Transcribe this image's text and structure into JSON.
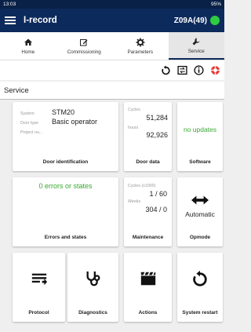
{
  "status": {
    "time": "13:03",
    "battery": "95%"
  },
  "app": {
    "title": "I-record",
    "device": "Z09A(49)"
  },
  "tabs": [
    {
      "label": "Home",
      "icon": "home-icon"
    },
    {
      "label": "Commissioning",
      "icon": "edit-icon"
    },
    {
      "label": "Parameters",
      "icon": "gear-icon"
    },
    {
      "label": "Service",
      "icon": "wrench-icon"
    }
  ],
  "section": {
    "title": "Service"
  },
  "door": {
    "system_label": "System",
    "system": "STM20",
    "doortype_label": "Door type",
    "doortype": "Basic operator",
    "project_label": "Project nu...",
    "caption": "Door identification"
  },
  "doordata": {
    "cycles_label": "Cycles",
    "cycles": "51,284",
    "hours_label": "hours",
    "hours": "92,926",
    "caption": "Door data"
  },
  "software": {
    "status": "no updates",
    "caption": "Software"
  },
  "errors": {
    "status": "0 errors or states",
    "caption": "Errors and states"
  },
  "maintenance": {
    "cycles_label": "Cycles (x1000)",
    "cycles": "1 / 60",
    "weeks_label": "Weeks",
    "weeks": "304 / 0",
    "caption": "Maintenance"
  },
  "opmode": {
    "mode": "Automatic",
    "caption": "Opmode"
  },
  "tiles": {
    "protocol": "Protocol",
    "diagnostics": "Diagnostics",
    "actions": "Actions",
    "restart": "System restart"
  },
  "colors": {
    "appbar": "#0d2a5c",
    "green": "#3aa832",
    "danger": "#e53935"
  }
}
